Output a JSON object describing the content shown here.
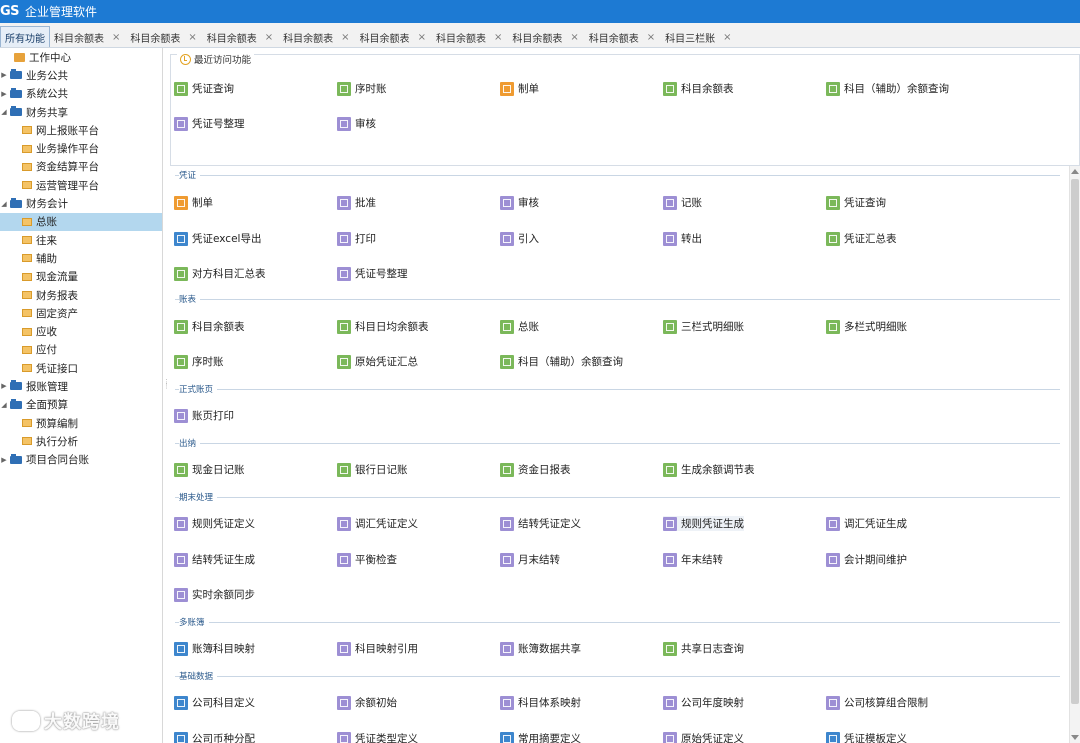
{
  "titlebar": {
    "logo": "GS",
    "title": "企业管理软件"
  },
  "tabs": [
    {
      "label": "所有功能"
    },
    {
      "label": "科目余额表"
    },
    {
      "label": "科目余额表"
    },
    {
      "label": "科目余额表"
    },
    {
      "label": "科目余额表"
    },
    {
      "label": "科目余额表"
    },
    {
      "label": "科目余额表"
    },
    {
      "label": "科目余额表"
    },
    {
      "label": "科目余额表"
    },
    {
      "label": "科目三栏账"
    }
  ],
  "tab_close": "×",
  "sidebar": {
    "items": [
      {
        "label": "工作中心"
      },
      {
        "label": "业务公共"
      },
      {
        "label": "系统公共"
      },
      {
        "label": "财务共享"
      },
      {
        "label": "网上报账平台"
      },
      {
        "label": "业务操作平台"
      },
      {
        "label": "资金结算平台"
      },
      {
        "label": "运营管理平台"
      },
      {
        "label": "财务会计"
      },
      {
        "label": "总账"
      },
      {
        "label": "往来"
      },
      {
        "label": "辅助"
      },
      {
        "label": "现金流量"
      },
      {
        "label": "财务报表"
      },
      {
        "label": "固定资产"
      },
      {
        "label": "应收"
      },
      {
        "label": "应付"
      },
      {
        "label": "凭证接口"
      },
      {
        "label": "报账管理"
      },
      {
        "label": "全面预算"
      },
      {
        "label": "预算编制"
      },
      {
        "label": "执行分析"
      },
      {
        "label": "项目合同台账"
      }
    ]
  },
  "recent": {
    "title": "最近访问功能",
    "items": [
      {
        "label": "凭证查询"
      },
      {
        "label": "序时账"
      },
      {
        "label": "制单"
      },
      {
        "label": "科目余额表"
      },
      {
        "label": "科目（辅助）余额查询"
      },
      {
        "label": "凭证号整理"
      },
      {
        "label": "审核"
      }
    ]
  },
  "sections": {
    "voucher": {
      "title": "凭证",
      "items": [
        {
          "label": "制单"
        },
        {
          "label": "批准"
        },
        {
          "label": "审核"
        },
        {
          "label": "记账"
        },
        {
          "label": "凭证查询"
        },
        {
          "label": "凭证excel导出"
        },
        {
          "label": "打印"
        },
        {
          "label": "引入"
        },
        {
          "label": "转出"
        },
        {
          "label": "凭证汇总表"
        },
        {
          "label": "对方科目汇总表"
        },
        {
          "label": "凭证号整理"
        }
      ]
    },
    "ledger": {
      "title": "账表",
      "items": [
        {
          "label": "科目余额表"
        },
        {
          "label": "科目日均余额表"
        },
        {
          "label": "总账"
        },
        {
          "label": "三栏式明细账"
        },
        {
          "label": "多栏式明细账"
        },
        {
          "label": "序时账"
        },
        {
          "label": "原始凭证汇总"
        },
        {
          "label": "科目（辅助）余额查询"
        }
      ]
    },
    "formal": {
      "title": "正式账页",
      "items": [
        {
          "label": "账页打印"
        }
      ]
    },
    "cashier": {
      "title": "出纳",
      "items": [
        {
          "label": "现金日记账"
        },
        {
          "label": "银行日记账"
        },
        {
          "label": "资金日报表"
        },
        {
          "label": "生成余额调节表"
        }
      ]
    },
    "closing": {
      "title": "期末处理",
      "items": [
        {
          "label": "规则凭证定义"
        },
        {
          "label": "调汇凭证定义"
        },
        {
          "label": "结转凭证定义"
        },
        {
          "label": "规则凭证生成"
        },
        {
          "label": "调汇凭证生成"
        },
        {
          "label": "结转凭证生成"
        },
        {
          "label": "平衡检查"
        },
        {
          "label": "月末结转"
        },
        {
          "label": "年末结转"
        },
        {
          "label": "会计期间维护"
        },
        {
          "label": "实时余额同步"
        }
      ]
    },
    "multibook": {
      "title": "多账簿",
      "items": [
        {
          "label": "账簿科目映射"
        },
        {
          "label": "科目映射引用"
        },
        {
          "label": "账簿数据共享"
        },
        {
          "label": "共享日志查询"
        }
      ]
    },
    "basic": {
      "title": "基础数据",
      "items": [
        {
          "label": "公司科目定义"
        },
        {
          "label": "余额初始"
        },
        {
          "label": "科目体系映射"
        },
        {
          "label": "公司年度映射"
        },
        {
          "label": "公司核算组合限制"
        },
        {
          "label": "公司币种分配"
        },
        {
          "label": "凭证类型定义"
        },
        {
          "label": "常用摘要定义"
        },
        {
          "label": "原始凭证定义"
        },
        {
          "label": "凭证模板定义"
        }
      ]
    }
  },
  "watermark": "大数跨境",
  "colors": {
    "titlebar": "#1d7ad3",
    "selected": "#b3d7ee",
    "section_text": "#2b5a8c"
  }
}
